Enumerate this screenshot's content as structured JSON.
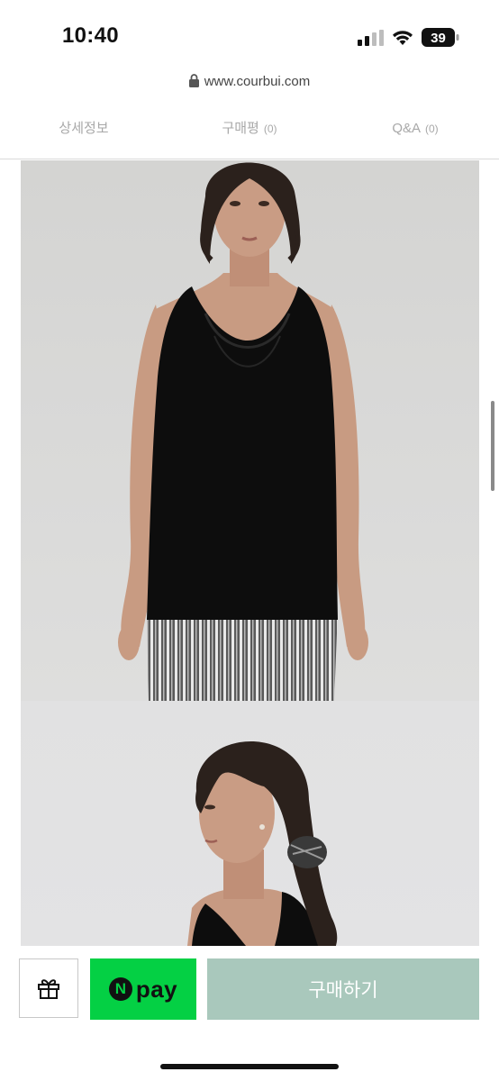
{
  "status_bar": {
    "time": "10:40",
    "battery_level": "39"
  },
  "browser": {
    "url": "www.courbui.com"
  },
  "tabs": [
    {
      "label": "상세정보",
      "count": ""
    },
    {
      "label": "구매평",
      "count": "(0)"
    },
    {
      "label": "Q&A",
      "count": "(0)"
    }
  ],
  "product_images": [
    {
      "description_icon": "model-photo-front"
    },
    {
      "description_icon": "model-photo-side"
    }
  ],
  "actions": {
    "gift_icon": "gift-icon",
    "npay_n": "N",
    "npay_label": "pay",
    "buy_label": "구매하기"
  },
  "colors": {
    "npay_green": "#04d044",
    "buy_button": "#a9c8bc",
    "tab_text": "#a8a8a8"
  }
}
